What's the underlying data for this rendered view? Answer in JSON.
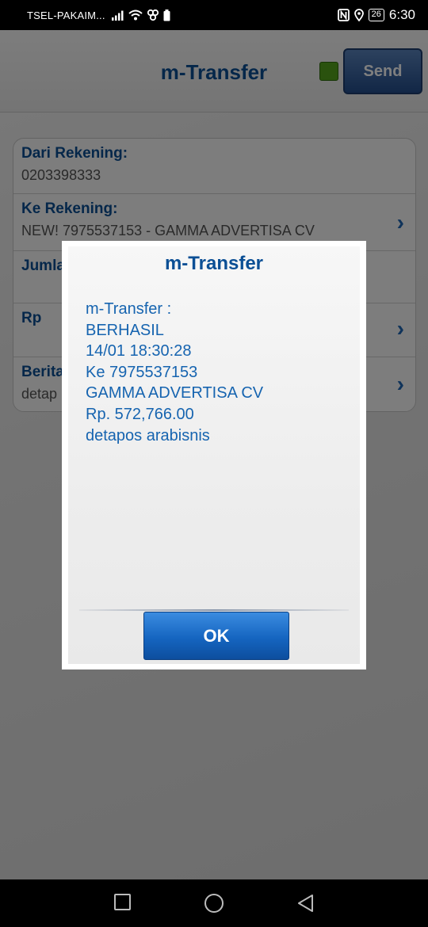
{
  "status_bar": {
    "carrier": "TSEL-PAKAIM...",
    "battery": "26",
    "time": "6:30"
  },
  "app": {
    "title": "m-Transfer",
    "send_label": "Send",
    "status_color": "#55a51c",
    "form": {
      "rows": [
        {
          "label": "Dari Rekening:",
          "value": "0203398333"
        },
        {
          "label": "Ke Rekening:",
          "value": "NEW! 7975537153 - GAMMA ADVERTISA CV"
        },
        {
          "label": "Jumla",
          "value": ""
        },
        {
          "label": "Rp",
          "value": ""
        },
        {
          "label": "Berita",
          "value": "detap"
        }
      ]
    }
  },
  "dialog": {
    "title": "m-Transfer",
    "lines": [
      "m-Transfer :",
      "BERHASIL",
      "14/01 18:30:28",
      "Ke 7975537153",
      "GAMMA ADVERTISA CV",
      "Rp. 572,766.00",
      "detapos arabisnis"
    ],
    "ok_label": "OK"
  },
  "icons": {
    "chevron": "chevron-right-icon",
    "nav": [
      "recent-apps-icon",
      "home-icon",
      "back-icon"
    ]
  }
}
